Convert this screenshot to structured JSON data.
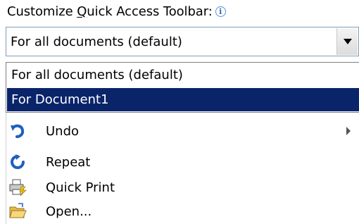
{
  "label": {
    "prefix": "Customize ",
    "underlined": "Q",
    "suffix": "uick Access Toolbar:",
    "info_icon": "info-icon"
  },
  "combo": {
    "value": "For all documents (default)",
    "button_icon": "chevron-down-icon"
  },
  "dropdown": {
    "options": [
      {
        "label": "For all documents (default)",
        "selected": false
      },
      {
        "label": "For Document1",
        "selected": true
      }
    ],
    "highlight_color": "#0a246a"
  },
  "commands": [
    {
      "label": "Undo",
      "icon": "undo-icon",
      "has_submenu": true
    },
    {
      "label": "Repeat",
      "icon": "repeat-icon",
      "has_submenu": false
    },
    {
      "label": "Quick Print",
      "icon": "quick-print-icon",
      "has_submenu": false
    },
    {
      "label": "Open...",
      "icon": "open-folder-icon",
      "has_submenu": false
    }
  ]
}
